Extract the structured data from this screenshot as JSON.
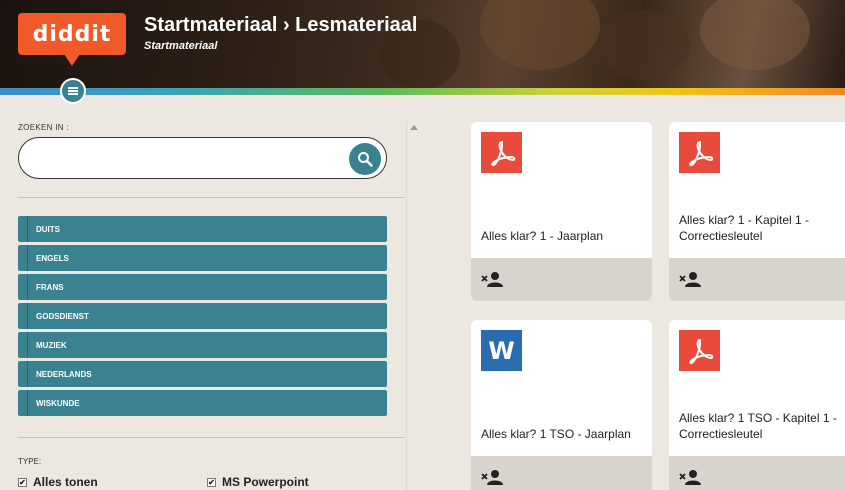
{
  "header": {
    "logo": "diddit",
    "title": "Startmateriaal › Lesmateriaal",
    "subtitle": "Startmateriaal"
  },
  "sidebar": {
    "search_label": "ZOEKEN IN :",
    "search_value": "",
    "subjects": [
      "DUITS",
      "ENGELS",
      "FRANS",
      "GODSDIENST",
      "MUZIEK",
      "NEDERLANDS",
      "WISKUNDE"
    ],
    "type_label": "TYPE:",
    "filters": [
      "Alles tonen",
      "MS Powerpoint"
    ]
  },
  "cards": [
    {
      "icon": "pdf-icon",
      "name": "Alles klar? 1 - Jaarplan"
    },
    {
      "icon": "pdf-icon",
      "name": "Alles klar? 1 - Kapitel 1 - Correctiesleutel"
    },
    {
      "icon": "word-icon",
      "icon_text": "W",
      "name": "Alles klar? 1 TSO - Jaarplan"
    },
    {
      "icon": "pdf-icon",
      "name": "Alles klar? 1 TSO - Kapitel 1 - Correctiesleutel"
    }
  ],
  "colors": {
    "accent": "#3a8290",
    "logo": "#f05a28",
    "pdf": "#e84b3c",
    "word": "#2b6cb0"
  }
}
